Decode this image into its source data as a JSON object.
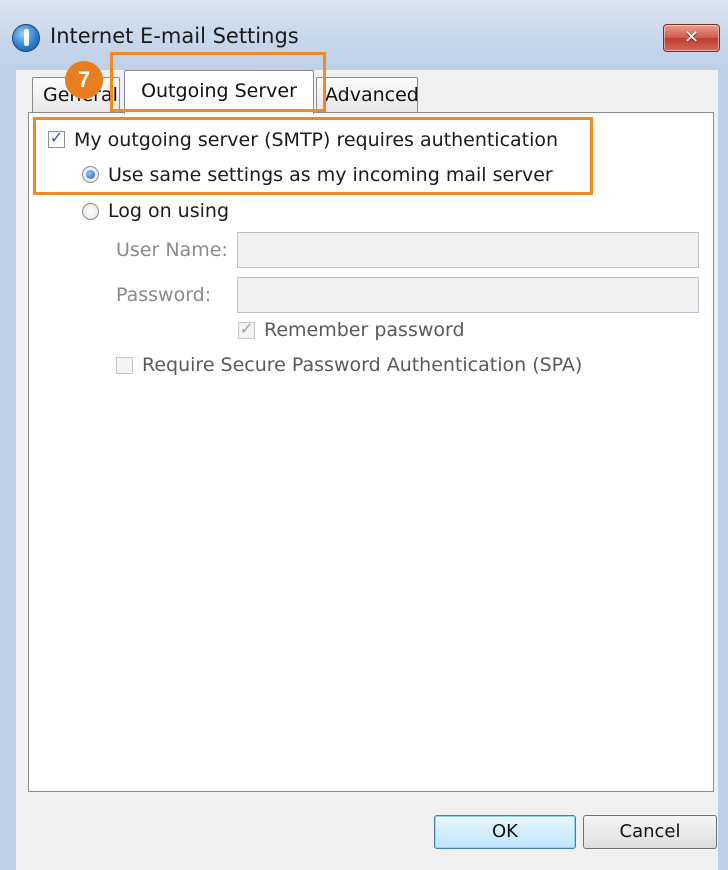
{
  "window": {
    "title": "Internet E-mail Settings",
    "close_label": "✕"
  },
  "tabs": [
    {
      "label": "General",
      "active": false
    },
    {
      "label": "Outgoing Server",
      "active": true
    },
    {
      "label": "Advanced",
      "active": false
    }
  ],
  "annotation": {
    "step_number": "7",
    "highlight_color": "#f08a24"
  },
  "outgoing": {
    "auth_checkbox_label": "My outgoing server (SMTP) requires authentication",
    "auth_checked": true,
    "same_settings_label": "Use same settings as my incoming mail server",
    "same_settings_selected": true,
    "logon_label": "Log on using",
    "logon_selected": false,
    "username_label": "User Name:",
    "username_value": "",
    "password_label": "Password:",
    "password_value": "",
    "remember_label": "Remember password",
    "remember_checked": true,
    "spa_label": "Require Secure Password Authentication (SPA)",
    "spa_checked": false
  },
  "buttons": {
    "ok": "OK",
    "cancel": "Cancel"
  }
}
